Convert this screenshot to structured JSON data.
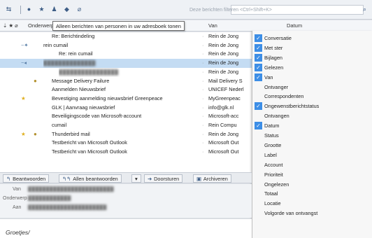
{
  "filterbar": {
    "icons": [
      "reply-icon",
      "unread-icon",
      "star-icon",
      "contact-icon",
      "tag-icon",
      "attachment-icon"
    ],
    "search_placeholder": "Deze berichten filteren <Ctrl+Shift+K>"
  },
  "columns": {
    "subject": "Onderwerp",
    "from": "Van",
    "date": "Datum"
  },
  "tooltip": "Alleen berichten van personen in uw adresboek tonen",
  "messages": [
    {
      "subject": "Re: Berichtindeling",
      "from": "Rein de Jong",
      "bold": false
    },
    {
      "subject": "rein cumail",
      "from": "Rein de Jong",
      "bold": false
    },
    {
      "subject": "Re: rein cumail",
      "from": "Rein de Jong",
      "bold": false
    },
    {
      "subject": "",
      "from": "Rein de Jong",
      "bold": false
    },
    {
      "subject": "",
      "from": "Rein de Jong",
      "bold": false
    },
    {
      "subject": "Message Delivery Failure",
      "from": "Mail Delivery S",
      "bold": false
    },
    {
      "subject": "Aanmelden Nieuwsbrief",
      "from": "UNICEF Nederl",
      "bold": false
    },
    {
      "subject": "Bevestiging aanmelding nieuwsbrief Greenpeace",
      "from": "MyGreenpeac",
      "bold": false
    },
    {
      "subject": "GLK | Aanvraag nieuwsbrief",
      "from": "info@glk.nl",
      "bold": false
    },
    {
      "subject": "Beveiligingscode van Microsoft-account",
      "from": "Microsoft-acc",
      "bold": false
    },
    {
      "subject": "cumail",
      "from": "Rein Compu",
      "bold": false
    },
    {
      "subject": "Thunderbird mail",
      "from": "Rein de Jong",
      "bold": false
    },
    {
      "subject": "Testbericht van Microsoft Outlook",
      "from": "Microsoft Out",
      "bold": false
    },
    {
      "subject": "Testbericht van Microsoft Outlook",
      "from": "Microsoft Out",
      "bold": false
    }
  ],
  "menu": {
    "items": [
      {
        "label": "Conversatie",
        "checked": true
      },
      {
        "label": "Met ster",
        "checked": true
      },
      {
        "label": "Bijlagen",
        "checked": true
      },
      {
        "label": "Gelezen",
        "checked": true
      },
      {
        "label": "Van",
        "checked": true
      },
      {
        "label": "Ontvanger",
        "checked": false
      },
      {
        "label": "Correspondenten",
        "checked": false
      },
      {
        "label": "Ongewenstberichtstatus",
        "checked": true
      },
      {
        "label": "Ontvangen",
        "checked": false
      },
      {
        "label": "Datum",
        "checked": true
      },
      {
        "label": "Status",
        "checked": false
      },
      {
        "label": "Grootte",
        "checked": false
      },
      {
        "label": "Label",
        "checked": false
      },
      {
        "label": "Account",
        "checked": false
      },
      {
        "label": "Prioriteit",
        "checked": false
      },
      {
        "label": "Ongelezen",
        "checked": false
      },
      {
        "label": "Totaal",
        "checked": false
      },
      {
        "label": "Locatie",
        "checked": false
      },
      {
        "label": "Volgorde van ontvangst",
        "checked": false
      }
    ]
  },
  "toolbar": {
    "reply": "Beantwoorden",
    "reply_all": "Allen beantwoorden",
    "forward": "Doorsturen",
    "archive": "Archiveren"
  },
  "preview": {
    "from_label": "Van",
    "from_value": "",
    "subject_label": "Onderwerp",
    "subject_value": "",
    "to_label": "Aan",
    "to_value": "",
    "greeting": "Groetjes/"
  }
}
